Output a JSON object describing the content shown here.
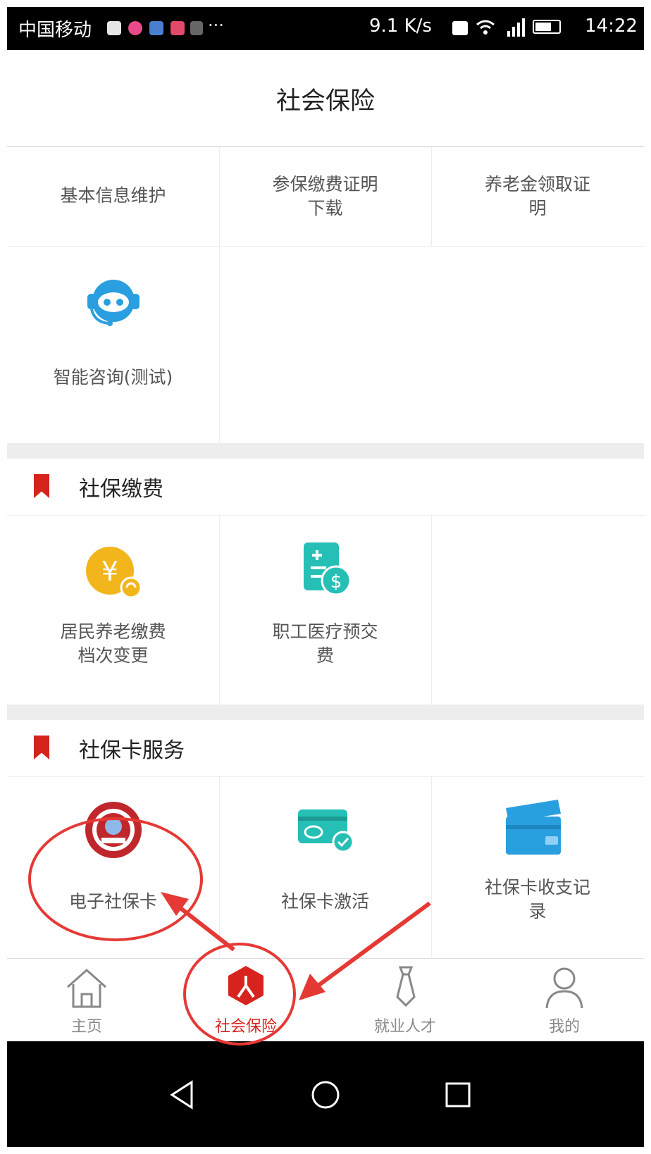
{
  "status_bar": {
    "carrier": "中国移动",
    "more": "···",
    "speed": "9.1 K/s",
    "time": "14:22"
  },
  "header": {
    "title": "社会保险"
  },
  "top_grid": {
    "items": [
      {
        "label": "基本信息维护"
      },
      {
        "label": "参保缴费证明\n下载"
      },
      {
        "label": "养老金领取证\n明"
      },
      {
        "label": "智能咨询(测试)",
        "icon": "robot-headset-icon"
      }
    ]
  },
  "section_payment": {
    "title": "社保缴费",
    "items": [
      {
        "label": "居民养老缴费\n档次变更",
        "icon": "yuan-coin-icon"
      },
      {
        "label": "职工医疗预交\n费",
        "icon": "medical-bill-icon"
      }
    ]
  },
  "section_card": {
    "title": "社保卡服务",
    "items": [
      {
        "label": "电子社保卡",
        "icon": "social-security-seal-icon"
      },
      {
        "label": "社保卡激活",
        "icon": "card-activate-icon"
      },
      {
        "label": "社保卡收支记\n录",
        "icon": "card-wallet-icon"
      }
    ]
  },
  "bottom_nav": {
    "items": [
      {
        "label": "主页",
        "icon": "home-icon"
      },
      {
        "label": "社会保险",
        "icon": "insurance-hexagon-icon",
        "active": true
      },
      {
        "label": "就业人才",
        "icon": "tie-icon"
      },
      {
        "label": "我的",
        "icon": "person-icon"
      }
    ]
  },
  "colors": {
    "accent_red": "#d6231d",
    "annotation_red": "#e53935",
    "icon_blue": "#2a9fe0",
    "icon_teal": "#26bfb6",
    "icon_yellow": "#f2b51c"
  }
}
